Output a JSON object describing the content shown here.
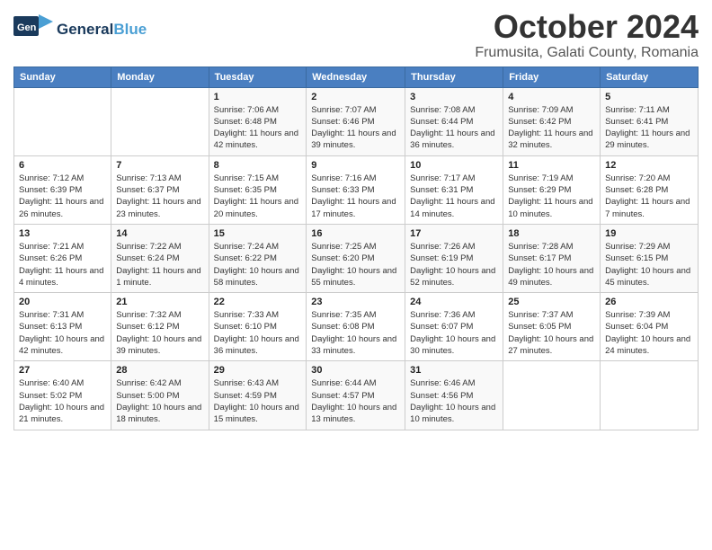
{
  "header": {
    "logo_general": "General",
    "logo_blue": "Blue",
    "title": "October 2024",
    "subtitle": "Frumusita, Galati County, Romania"
  },
  "weekdays": [
    "Sunday",
    "Monday",
    "Tuesday",
    "Wednesday",
    "Thursday",
    "Friday",
    "Saturday"
  ],
  "weeks": [
    [
      {
        "day": "",
        "sunrise": "",
        "sunset": "",
        "daylight": ""
      },
      {
        "day": "",
        "sunrise": "",
        "sunset": "",
        "daylight": ""
      },
      {
        "day": "1",
        "sunrise": "Sunrise: 7:06 AM",
        "sunset": "Sunset: 6:48 PM",
        "daylight": "Daylight: 11 hours and 42 minutes."
      },
      {
        "day": "2",
        "sunrise": "Sunrise: 7:07 AM",
        "sunset": "Sunset: 6:46 PM",
        "daylight": "Daylight: 11 hours and 39 minutes."
      },
      {
        "day": "3",
        "sunrise": "Sunrise: 7:08 AM",
        "sunset": "Sunset: 6:44 PM",
        "daylight": "Daylight: 11 hours and 36 minutes."
      },
      {
        "day": "4",
        "sunrise": "Sunrise: 7:09 AM",
        "sunset": "Sunset: 6:42 PM",
        "daylight": "Daylight: 11 hours and 32 minutes."
      },
      {
        "day": "5",
        "sunrise": "Sunrise: 7:11 AM",
        "sunset": "Sunset: 6:41 PM",
        "daylight": "Daylight: 11 hours and 29 minutes."
      }
    ],
    [
      {
        "day": "6",
        "sunrise": "Sunrise: 7:12 AM",
        "sunset": "Sunset: 6:39 PM",
        "daylight": "Daylight: 11 hours and 26 minutes."
      },
      {
        "day": "7",
        "sunrise": "Sunrise: 7:13 AM",
        "sunset": "Sunset: 6:37 PM",
        "daylight": "Daylight: 11 hours and 23 minutes."
      },
      {
        "day": "8",
        "sunrise": "Sunrise: 7:15 AM",
        "sunset": "Sunset: 6:35 PM",
        "daylight": "Daylight: 11 hours and 20 minutes."
      },
      {
        "day": "9",
        "sunrise": "Sunrise: 7:16 AM",
        "sunset": "Sunset: 6:33 PM",
        "daylight": "Daylight: 11 hours and 17 minutes."
      },
      {
        "day": "10",
        "sunrise": "Sunrise: 7:17 AM",
        "sunset": "Sunset: 6:31 PM",
        "daylight": "Daylight: 11 hours and 14 minutes."
      },
      {
        "day": "11",
        "sunrise": "Sunrise: 7:19 AM",
        "sunset": "Sunset: 6:29 PM",
        "daylight": "Daylight: 11 hours and 10 minutes."
      },
      {
        "day": "12",
        "sunrise": "Sunrise: 7:20 AM",
        "sunset": "Sunset: 6:28 PM",
        "daylight": "Daylight: 11 hours and 7 minutes."
      }
    ],
    [
      {
        "day": "13",
        "sunrise": "Sunrise: 7:21 AM",
        "sunset": "Sunset: 6:26 PM",
        "daylight": "Daylight: 11 hours and 4 minutes."
      },
      {
        "day": "14",
        "sunrise": "Sunrise: 7:22 AM",
        "sunset": "Sunset: 6:24 PM",
        "daylight": "Daylight: 11 hours and 1 minute."
      },
      {
        "day": "15",
        "sunrise": "Sunrise: 7:24 AM",
        "sunset": "Sunset: 6:22 PM",
        "daylight": "Daylight: 10 hours and 58 minutes."
      },
      {
        "day": "16",
        "sunrise": "Sunrise: 7:25 AM",
        "sunset": "Sunset: 6:20 PM",
        "daylight": "Daylight: 10 hours and 55 minutes."
      },
      {
        "day": "17",
        "sunrise": "Sunrise: 7:26 AM",
        "sunset": "Sunset: 6:19 PM",
        "daylight": "Daylight: 10 hours and 52 minutes."
      },
      {
        "day": "18",
        "sunrise": "Sunrise: 7:28 AM",
        "sunset": "Sunset: 6:17 PM",
        "daylight": "Daylight: 10 hours and 49 minutes."
      },
      {
        "day": "19",
        "sunrise": "Sunrise: 7:29 AM",
        "sunset": "Sunset: 6:15 PM",
        "daylight": "Daylight: 10 hours and 45 minutes."
      }
    ],
    [
      {
        "day": "20",
        "sunrise": "Sunrise: 7:31 AM",
        "sunset": "Sunset: 6:13 PM",
        "daylight": "Daylight: 10 hours and 42 minutes."
      },
      {
        "day": "21",
        "sunrise": "Sunrise: 7:32 AM",
        "sunset": "Sunset: 6:12 PM",
        "daylight": "Daylight: 10 hours and 39 minutes."
      },
      {
        "day": "22",
        "sunrise": "Sunrise: 7:33 AM",
        "sunset": "Sunset: 6:10 PM",
        "daylight": "Daylight: 10 hours and 36 minutes."
      },
      {
        "day": "23",
        "sunrise": "Sunrise: 7:35 AM",
        "sunset": "Sunset: 6:08 PM",
        "daylight": "Daylight: 10 hours and 33 minutes."
      },
      {
        "day": "24",
        "sunrise": "Sunrise: 7:36 AM",
        "sunset": "Sunset: 6:07 PM",
        "daylight": "Daylight: 10 hours and 30 minutes."
      },
      {
        "day": "25",
        "sunrise": "Sunrise: 7:37 AM",
        "sunset": "Sunset: 6:05 PM",
        "daylight": "Daylight: 10 hours and 27 minutes."
      },
      {
        "day": "26",
        "sunrise": "Sunrise: 7:39 AM",
        "sunset": "Sunset: 6:04 PM",
        "daylight": "Daylight: 10 hours and 24 minutes."
      }
    ],
    [
      {
        "day": "27",
        "sunrise": "Sunrise: 6:40 AM",
        "sunset": "Sunset: 5:02 PM",
        "daylight": "Daylight: 10 hours and 21 minutes."
      },
      {
        "day": "28",
        "sunrise": "Sunrise: 6:42 AM",
        "sunset": "Sunset: 5:00 PM",
        "daylight": "Daylight: 10 hours and 18 minutes."
      },
      {
        "day": "29",
        "sunrise": "Sunrise: 6:43 AM",
        "sunset": "Sunset: 4:59 PM",
        "daylight": "Daylight: 10 hours and 15 minutes."
      },
      {
        "day": "30",
        "sunrise": "Sunrise: 6:44 AM",
        "sunset": "Sunset: 4:57 PM",
        "daylight": "Daylight: 10 hours and 13 minutes."
      },
      {
        "day": "31",
        "sunrise": "Sunrise: 6:46 AM",
        "sunset": "Sunset: 4:56 PM",
        "daylight": "Daylight: 10 hours and 10 minutes."
      },
      {
        "day": "",
        "sunrise": "",
        "sunset": "",
        "daylight": ""
      },
      {
        "day": "",
        "sunrise": "",
        "sunset": "",
        "daylight": ""
      }
    ]
  ]
}
